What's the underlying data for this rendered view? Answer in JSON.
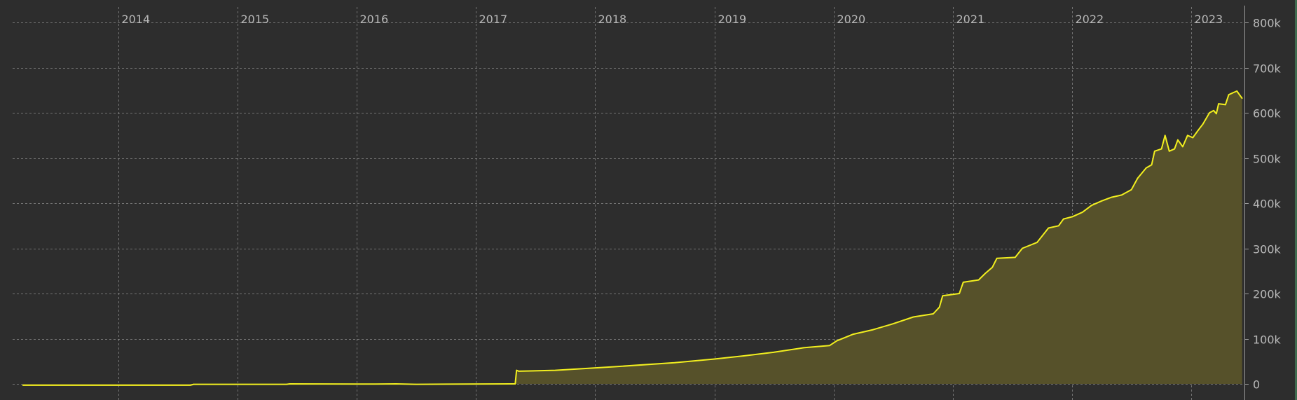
{
  "theme": {
    "background": "#2d2d2d",
    "line_color": "#f2ef1f",
    "fill_color": "#56512a",
    "grid_color": "#8a8a8a",
    "label_color": "#b8b8b8",
    "edge_accent": "#3f6b4f"
  },
  "chart_data": {
    "type": "area",
    "title": "",
    "xlabel": "",
    "ylabel": "",
    "grid": true,
    "legend": "none",
    "y_axis_position": "right",
    "x_axis_labels_position": "top",
    "xlim": [
      "2013-03-01",
      "2023-06-10"
    ],
    "ylim": [
      0,
      800000
    ],
    "x_ticks": [
      {
        "date": "2014-01-01",
        "label": "2014"
      },
      {
        "date": "2015-01-01",
        "label": "2015"
      },
      {
        "date": "2016-01-01",
        "label": "2016"
      },
      {
        "date": "2017-01-01",
        "label": "2017"
      },
      {
        "date": "2018-01-01",
        "label": "2018"
      },
      {
        "date": "2019-01-01",
        "label": "2019"
      },
      {
        "date": "2020-01-01",
        "label": "2020"
      },
      {
        "date": "2021-01-01",
        "label": "2021"
      },
      {
        "date": "2022-01-01",
        "label": "2022"
      },
      {
        "date": "2023-01-01",
        "label": "2023"
      }
    ],
    "y_ticks": [
      {
        "value": 0,
        "label": "0"
      },
      {
        "value": 100000,
        "label": "100k"
      },
      {
        "value": 200000,
        "label": "200k"
      },
      {
        "value": 300000,
        "label": "300k"
      },
      {
        "value": 400000,
        "label": "400k"
      },
      {
        "value": 500000,
        "label": "500k"
      },
      {
        "value": 600000,
        "label": "600k"
      },
      {
        "value": 700000,
        "label": "700k"
      },
      {
        "value": 800000,
        "label": "800k"
      }
    ],
    "series": [
      {
        "points": [
          [
            "2013-03-15",
            -3000
          ],
          [
            "2014-08-10",
            -3000
          ],
          [
            "2014-08-20",
            -1000
          ],
          [
            "2015-06-01",
            -1000
          ],
          [
            "2015-06-10",
            0
          ],
          [
            "2016-03-01",
            -500
          ],
          [
            "2016-05-01",
            0
          ],
          [
            "2016-07-01",
            -1000
          ],
          [
            "2017-04-15",
            0
          ],
          [
            "2017-05-01",
            0
          ],
          [
            "2017-05-05",
            30000
          ],
          [
            "2017-05-12",
            28000
          ],
          [
            "2017-09-01",
            30000
          ],
          [
            "2018-03-01",
            38000
          ],
          [
            "2018-09-01",
            47000
          ],
          [
            "2019-01-01",
            55000
          ],
          [
            "2019-04-01",
            62000
          ],
          [
            "2019-07-01",
            70000
          ],
          [
            "2019-10-01",
            80000
          ],
          [
            "2019-12-20",
            85000
          ],
          [
            "2020-01-10",
            95000
          ],
          [
            "2020-03-01",
            110000
          ],
          [
            "2020-05-01",
            120000
          ],
          [
            "2020-07-01",
            133000
          ],
          [
            "2020-09-01",
            148000
          ],
          [
            "2020-11-01",
            155000
          ],
          [
            "2020-11-20",
            170000
          ],
          [
            "2020-11-30",
            195000
          ],
          [
            "2021-01-20",
            200000
          ],
          [
            "2021-02-01",
            225000
          ],
          [
            "2021-03-20",
            230000
          ],
          [
            "2021-04-10",
            245000
          ],
          [
            "2021-05-01",
            258000
          ],
          [
            "2021-05-15",
            278000
          ],
          [
            "2021-07-10",
            280000
          ],
          [
            "2021-08-01",
            300000
          ],
          [
            "2021-09-15",
            313000
          ],
          [
            "2021-10-20",
            345000
          ],
          [
            "2021-11-20",
            350000
          ],
          [
            "2021-12-05",
            365000
          ],
          [
            "2022-01-01",
            370000
          ],
          [
            "2022-02-01",
            380000
          ],
          [
            "2022-03-01",
            395000
          ],
          [
            "2022-04-01",
            405000
          ],
          [
            "2022-05-01",
            413000
          ],
          [
            "2022-06-01",
            418000
          ],
          [
            "2022-07-01",
            430000
          ],
          [
            "2022-07-20",
            455000
          ],
          [
            "2022-08-15",
            478000
          ],
          [
            "2022-09-01",
            485000
          ],
          [
            "2022-09-10",
            515000
          ],
          [
            "2022-10-01",
            520000
          ],
          [
            "2022-10-12",
            550000
          ],
          [
            "2022-10-25",
            515000
          ],
          [
            "2022-11-10",
            520000
          ],
          [
            "2022-11-20",
            540000
          ],
          [
            "2022-12-05",
            525000
          ],
          [
            "2022-12-20",
            550000
          ],
          [
            "2023-01-05",
            545000
          ],
          [
            "2023-01-20",
            560000
          ],
          [
            "2023-02-05",
            575000
          ],
          [
            "2023-02-25",
            600000
          ],
          [
            "2023-03-10",
            605000
          ],
          [
            "2023-03-18",
            598000
          ],
          [
            "2023-03-25",
            620000
          ],
          [
            "2023-04-15",
            618000
          ],
          [
            "2023-04-25",
            640000
          ],
          [
            "2023-05-10",
            645000
          ],
          [
            "2023-05-20",
            648000
          ],
          [
            "2023-05-28",
            640000
          ],
          [
            "2023-06-05",
            632000
          ]
        ]
      }
    ]
  }
}
